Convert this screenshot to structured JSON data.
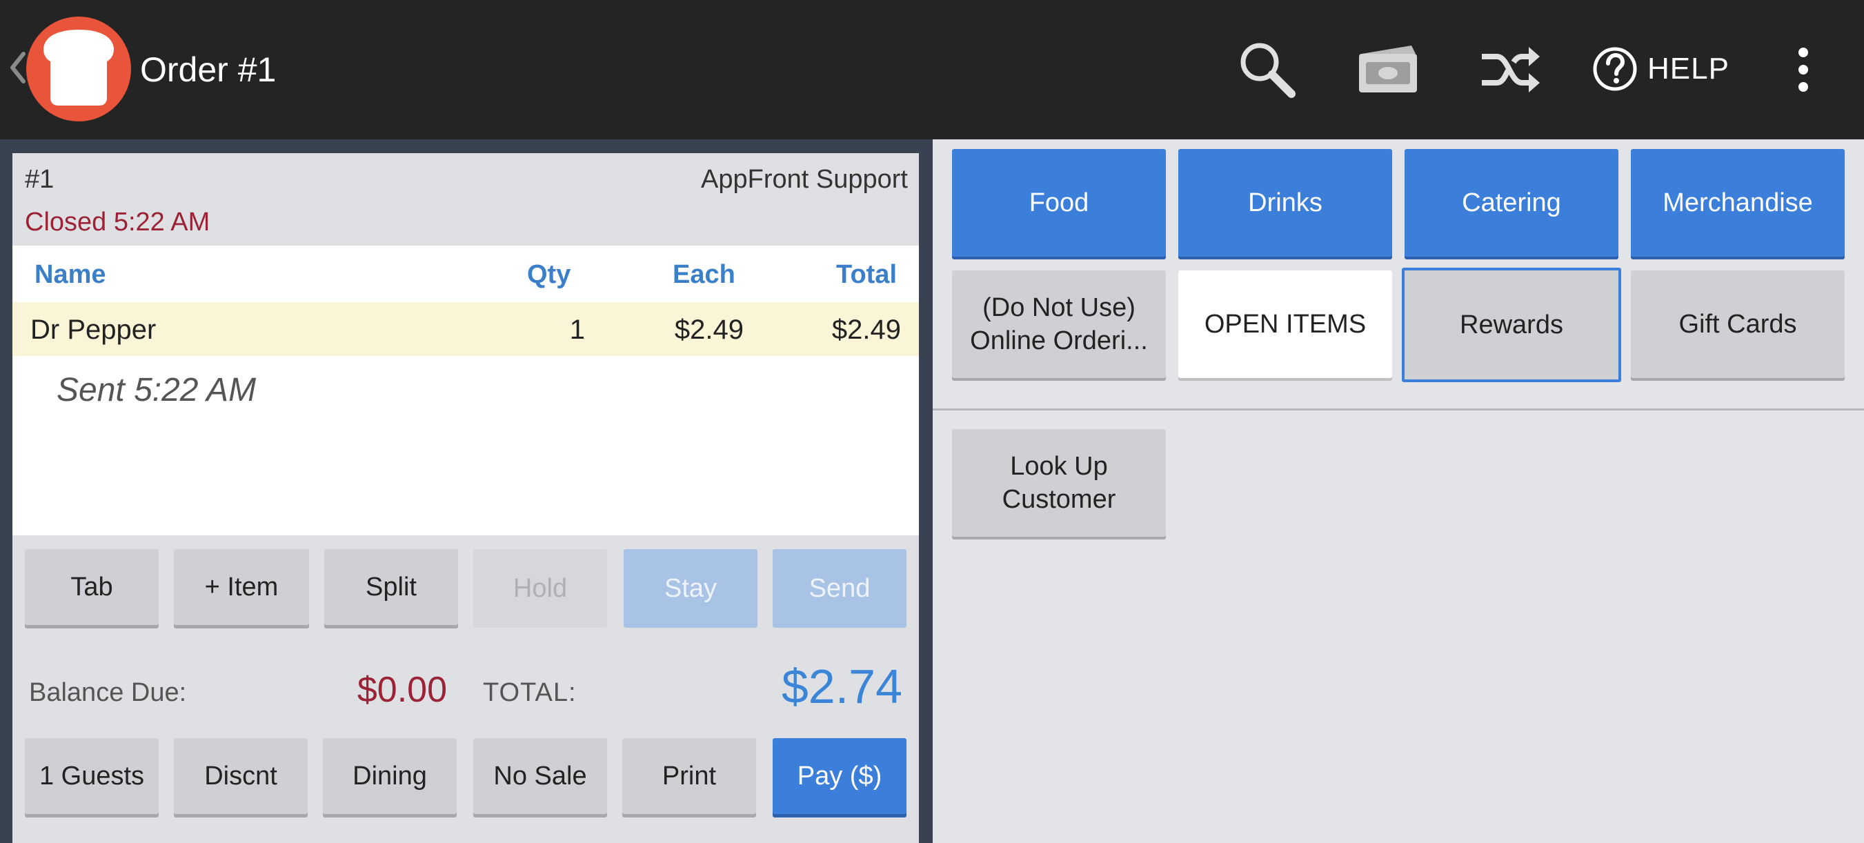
{
  "header": {
    "title": "Order #1",
    "help_label": "HELP",
    "icons": [
      "back-chevron-icon",
      "toast-logo-icon",
      "search-icon",
      "cash-drawer-icon",
      "shuffle-icon",
      "help-icon",
      "more-vert-icon"
    ]
  },
  "order": {
    "number": "#1",
    "server": "AppFront Support",
    "status": "Closed 5:22 AM",
    "columns": {
      "name": "Name",
      "qty": "Qty",
      "each": "Each",
      "total": "Total"
    },
    "items": [
      {
        "name": "Dr Pepper",
        "qty": "1",
        "each": "$2.49",
        "total": "$2.49",
        "sent": "Sent 5:22 AM"
      }
    ]
  },
  "actions_top": {
    "tab": "Tab",
    "add_item": "+ Item",
    "split": "Split",
    "hold": "Hold",
    "stay": "Stay",
    "send": "Send"
  },
  "totals": {
    "balance_label": "Balance Due:",
    "balance_value": "$0.00",
    "total_label": "TOTAL:",
    "total_value": "$2.74"
  },
  "actions_bottom": {
    "guests": "1 Guests",
    "discount": "Discnt",
    "dining": "Dining",
    "no_sale": "No Sale",
    "print": "Print",
    "pay": "Pay ($)"
  },
  "menu": {
    "categories": [
      {
        "label": "Food"
      },
      {
        "label": "Drinks"
      },
      {
        "label": "Catering"
      },
      {
        "label": "Merchandise"
      },
      {
        "label": "(Do Not Use) Online Orderi..."
      },
      {
        "label": "OPEN ITEMS"
      },
      {
        "label": "Rewards"
      },
      {
        "label": "Gift Cards"
      }
    ],
    "items": [
      {
        "label": "Look Up Customer"
      }
    ]
  },
  "colors": {
    "topbar": "#242424",
    "accent_blue": "#3b7fdb",
    "logo_orange": "#e8553a",
    "alert_red": "#9b2335",
    "item_highlight": "#faf5d6"
  }
}
